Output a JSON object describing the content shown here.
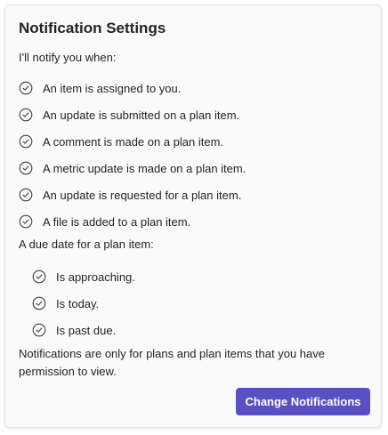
{
  "title": "Notification Settings",
  "intro": "I'll notify you when:",
  "items": [
    "An item is assigned to you.",
    "An update is submitted on a plan item.",
    "A comment is made on a plan item.",
    "A metric update is made on a plan item.",
    "An update is requested for a plan item.",
    "A file is added to a plan item."
  ],
  "due_heading": "A due date for a plan item:",
  "due_items": [
    "Is approaching.",
    "Is today.",
    "Is past due."
  ],
  "footnote": "Notifications are only for plans and plan items that you have permission to view.",
  "button_label": "Change Notifications",
  "colors": {
    "accent": "#5b4fc4",
    "text": "#242424",
    "card_bg": "#fafafa"
  },
  "icons": {
    "check": "circle-check-icon"
  }
}
